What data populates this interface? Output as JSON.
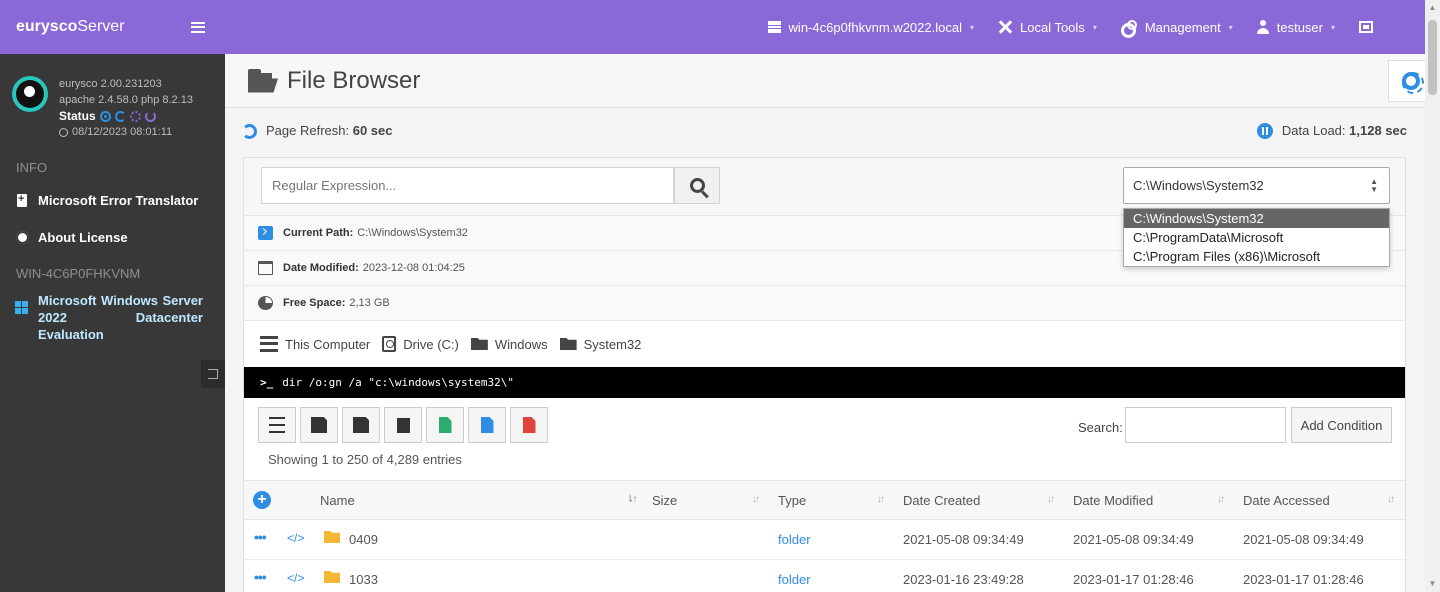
{
  "brand": {
    "bold": "eurysco",
    "light": "Server"
  },
  "sidebar": {
    "version": "eurysco 2.00.231203",
    "stack": "apache 2.4.58.0  php 8.2.13",
    "status_label": "Status",
    "datetime": "08/12/2023 08:01:11",
    "info_header": "INFO",
    "items": [
      {
        "label": "Microsoft Error Translator",
        "icon": "clipboard-plus-icon"
      },
      {
        "label": "About License",
        "icon": "gear-icon"
      }
    ],
    "host_header": "WIN-4C6P0FHKVNM",
    "os_label": "Microsoft Windows Server 2022 Datacenter Evaluation"
  },
  "topbar": {
    "host": "win-4c6p0fhkvnm.w2022.local",
    "local_tools": "Local Tools",
    "management": "Management",
    "user": "testuser"
  },
  "page": {
    "title": "File Browser",
    "refresh_label": "Page Refresh:",
    "refresh_value": "60 sec",
    "dataload_label": "Data Load:",
    "dataload_value": "1,128 sec"
  },
  "filter": {
    "regex_placeholder": "Regular Expression...",
    "path_selected": "C:\\Windows\\System32",
    "path_options": [
      "C:\\Windows\\System32",
      "C:\\ProgramData\\Microsoft",
      "C:\\Program Files (x86)\\Microsoft"
    ]
  },
  "info": {
    "current_path_label": "Current Path:",
    "current_path_value": "C:\\Windows\\System32",
    "date_modified_label": "Date Modified:",
    "date_modified_value": "2023-12-08 01:04:25",
    "free_space_label": "Free Space:",
    "free_space_value": "2,13 GB"
  },
  "breadcrumb": [
    "This Computer",
    "Drive (C:)",
    "Windows",
    "System32"
  ],
  "command": {
    "prompt": ">_",
    "text": "dir /o:gn /a \"c:\\windows\\system32\\\""
  },
  "toolbar": {
    "search_label": "Search:",
    "add_condition": "Add Condition"
  },
  "showing": {
    "prefix": "Showing",
    "from": "1",
    "mid1": "to",
    "to": "250",
    "mid2": "of",
    "total": "4,289",
    "suffix": "entries"
  },
  "table": {
    "columns": [
      "Name",
      "Size",
      "Type",
      "Date Created",
      "Date Modified",
      "Date Accessed"
    ],
    "rows": [
      {
        "name": "0409",
        "size": "",
        "type": "folder",
        "created": "2021-05-08 09:34:49",
        "modified": "2021-05-08 09:34:49",
        "accessed": "2021-05-08 09:34:49"
      },
      {
        "name": "1033",
        "size": "",
        "type": "folder",
        "created": "2023-01-16 23:49:28",
        "modified": "2023-01-17 01:28:46",
        "accessed": "2023-01-17 01:28:46"
      }
    ]
  },
  "colors": {
    "accent": "#8a68d8",
    "sidebar": "#383838",
    "link": "#2f8de4"
  }
}
